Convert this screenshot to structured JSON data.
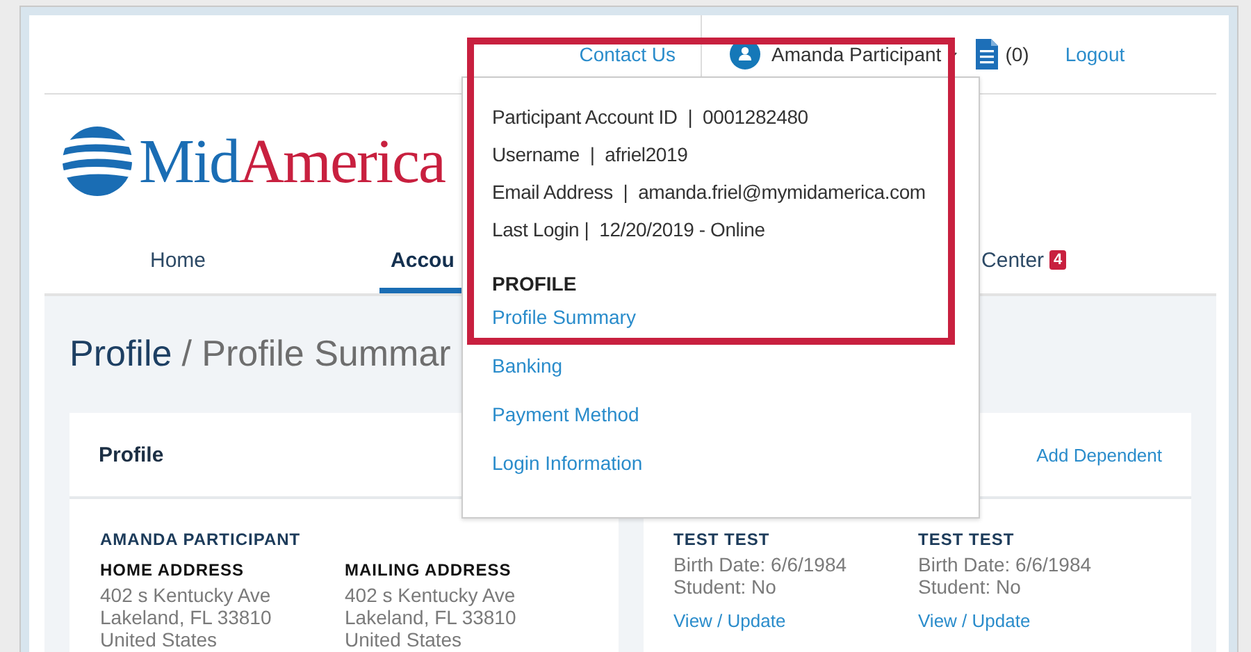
{
  "header": {
    "contact_link": "Contact Us",
    "user_name": "Amanda Participant",
    "cart_count": "(0)",
    "logout_link": "Logout"
  },
  "logo": {
    "first": "Mid",
    "second": "America"
  },
  "nav": [
    {
      "label": "Home",
      "selected": false
    },
    {
      "label": "Accou",
      "selected": true
    },
    {
      "label": "Center",
      "selected": false,
      "badge": "4"
    }
  ],
  "page_title": {
    "section": "Profile",
    "current": "/ Profile Summar"
  },
  "profile_card": {
    "title": "Profile",
    "action": "Add Dependent",
    "participant": "AMANDA PARTICIPANT",
    "addresses": [
      {
        "heading": "HOME ADDRESS",
        "lines": [
          "402 s Kentucky Ave",
          "Lakeland, FL 33810",
          "United States"
        ]
      },
      {
        "heading": "MAILING ADDRESS",
        "lines": [
          "402 s Kentucky Ave",
          "Lakeland, FL 33810",
          "United States"
        ]
      }
    ],
    "dependents": [
      {
        "name": "TEST TEST",
        "lines": [
          "Birth Date: 6/6/1984",
          "Student: No"
        ],
        "link": "View / Update"
      },
      {
        "name": "TEST TEST",
        "lines": [
          "Birth Date: 6/6/1984",
          "Student: No"
        ],
        "link": "View / Update"
      }
    ]
  },
  "account_menu": {
    "info": [
      "Participant Account ID  |  0001282480",
      "Username  |  afriel2019",
      "Email Address  |  amanda.friel@mymidamerica.com",
      "Last Login |  12/20/2019 - Online"
    ],
    "section": "PROFILE",
    "links": [
      "Profile Summary",
      "Banking",
      "Payment Method",
      "Login Information"
    ]
  }
}
